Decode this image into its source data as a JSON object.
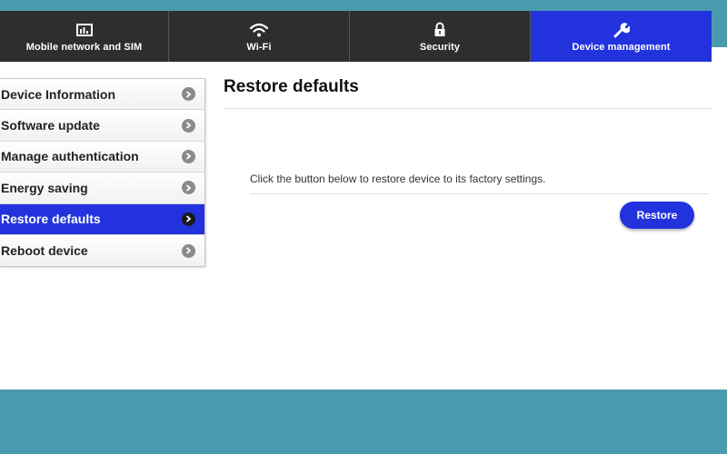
{
  "nav": {
    "tabs": [
      {
        "label": "Mobile network and SIM",
        "icon": "sim-card-icon"
      },
      {
        "label": "Wi-Fi",
        "icon": "wifi-icon"
      },
      {
        "label": "Security",
        "icon": "lock-icon"
      },
      {
        "label": "Device management",
        "icon": "wrench-icon",
        "active": true
      }
    ]
  },
  "sidebar": {
    "items": [
      {
        "label": "Device Information"
      },
      {
        "label": "Software update"
      },
      {
        "label": "Manage authentication"
      },
      {
        "label": "Energy saving"
      },
      {
        "label": "Restore defaults",
        "active": true
      },
      {
        "label": "Reboot device"
      }
    ]
  },
  "main": {
    "title": "Restore defaults",
    "description": "Click the button below to restore device to its factory settings.",
    "restore_label": "Restore"
  },
  "colors": {
    "accent": "#2233dd",
    "nav_bg": "#2e2e2e",
    "page_bg": "#4a9aad"
  }
}
